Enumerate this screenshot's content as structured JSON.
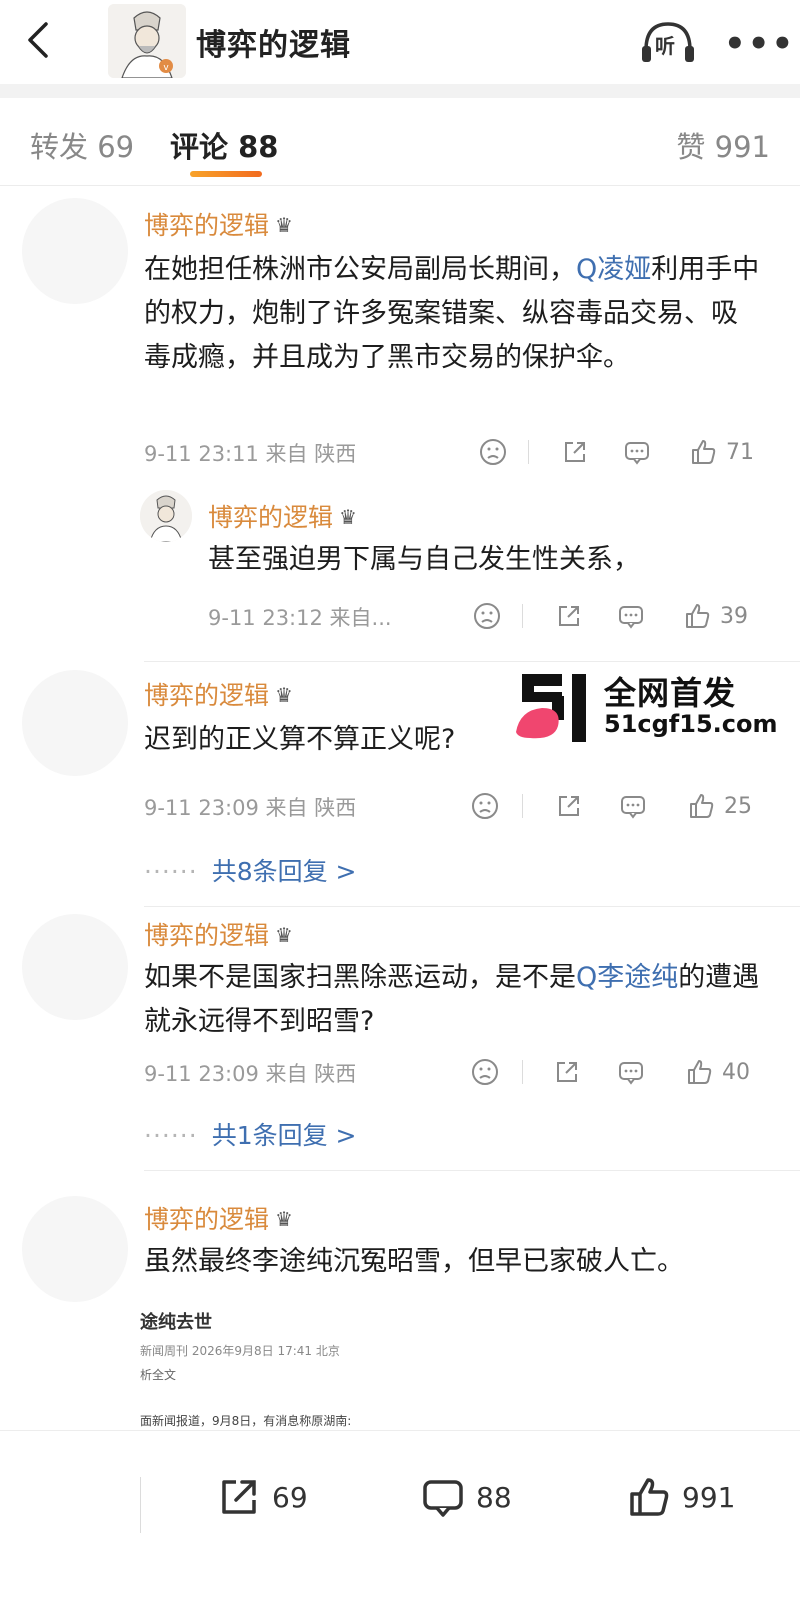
{
  "header": {
    "back_icon": "chevron-left-icon",
    "title": "博弈的逻辑",
    "listen_label": "听",
    "more_label": "•••"
  },
  "tabs": {
    "repost": "转发 69",
    "comment": "评论 88",
    "like": "赞 991"
  },
  "comments": [
    {
      "author": "博弈的逻辑",
      "text_parts": [
        "在她担任株洲市公安局副局长期间，",
        "Q凌娅",
        "利用手中的权力，炮制了许多冤案错案、纵容毒品交易、吸毒成瘾，并且成为了黑市交易的保护伞。"
      ],
      "meta": "9-11 23:11 来自 陕西",
      "likes": "71",
      "reply": {
        "author": "博弈的逻辑",
        "text": "甚至强迫男下属与自己发生性关系，",
        "meta": "9-11 23:12 来自...",
        "likes": "39"
      }
    },
    {
      "author": "博弈的逻辑",
      "text": "迟到的正义算不算正义呢?",
      "meta": "9-11 23:09 来自 陕西",
      "likes": "25",
      "replies": "共8条回复 >"
    },
    {
      "author": "博弈的逻辑",
      "text_parts": [
        "如果不是国家扫黑除恶运动，是不是",
        "Q李途纯",
        "的遭遇就永远得不到昭雪?"
      ],
      "meta": "9-11 23:09 来自 陕西",
      "likes": "40",
      "replies": "共1条回复 >"
    },
    {
      "author": "博弈的逻辑",
      "text": "虽然最终李途纯沉冤昭雪，但早已家破人亡。"
    }
  ],
  "news_image": {
    "title": "途纯去世",
    "source": "新闻周刊 2026年9月8日 17:41 北京",
    "full": "析全文",
    "body": "面新闻报道，9月8日，有消息称原湖南:"
  },
  "ad": {
    "title": "全网首发",
    "url": "51cgf15.com",
    "logo_text": "51"
  },
  "bottom_bar": {
    "repost_count": "69",
    "comment_count": "88",
    "like_count": "991"
  },
  "colors": {
    "author": "#d98a3c",
    "mention": "#3f6fb0",
    "accent": "#f26b1f",
    "ad_pink": "#f0466f"
  }
}
